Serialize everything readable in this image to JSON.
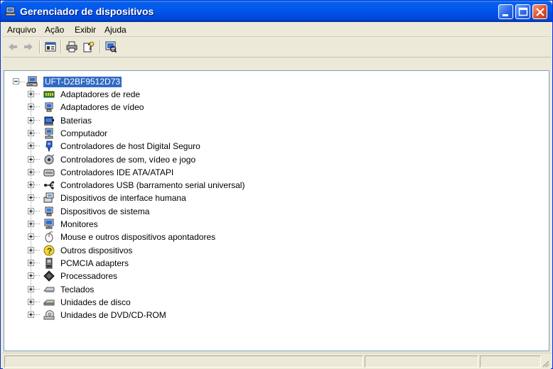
{
  "window": {
    "title": "Gerenciador de dispositivos",
    "colors": {
      "titlebar": "#0058ee",
      "selection": "#316ac5",
      "close": "#e0502a"
    }
  },
  "menubar": {
    "items": [
      {
        "label": "Arquivo"
      },
      {
        "label": "Ação"
      },
      {
        "label": "Exibir"
      },
      {
        "label": "Ajuda"
      }
    ]
  },
  "toolbar": {
    "buttons": [
      {
        "icon": "back-arrow-icon"
      },
      {
        "icon": "forward-arrow-icon"
      },
      {
        "icon": "properties-icon"
      },
      {
        "icon": "print-icon"
      },
      {
        "icon": "help-icon"
      },
      {
        "icon": "scan-hardware-icon"
      }
    ]
  },
  "tree": {
    "root": {
      "label": "UFT-D2BF9512D73",
      "icon": "computer-icon"
    },
    "items": [
      {
        "label": "Adaptadores de rede",
        "icon": "network-adapter-icon"
      },
      {
        "label": "Adaptadores de vídeo",
        "icon": "display-adapter-icon"
      },
      {
        "label": "Baterias",
        "icon": "battery-icon"
      },
      {
        "label": "Computador",
        "icon": "computer-icon"
      },
      {
        "label": "Controladores de host Digital Seguro",
        "icon": "sd-host-icon"
      },
      {
        "label": "Controladores de som, vídeo e jogo",
        "icon": "sound-icon"
      },
      {
        "label": "Controladores IDE ATA/ATAPI",
        "icon": "ide-controller-icon"
      },
      {
        "label": "Controladores USB (barramento serial universal)",
        "icon": "usb-icon"
      },
      {
        "label": "Dispositivos de interface humana",
        "icon": "hid-icon"
      },
      {
        "label": "Dispositivos de sistema",
        "icon": "system-device-icon"
      },
      {
        "label": "Monitores",
        "icon": "monitor-icon"
      },
      {
        "label": "Mouse e outros dispositivos apontadores",
        "icon": "mouse-icon"
      },
      {
        "label": "Outros dispositivos",
        "icon": "unknown-device-icon"
      },
      {
        "label": "PCMCIA adapters",
        "icon": "pcmcia-icon"
      },
      {
        "label": "Processadores",
        "icon": "processor-icon"
      },
      {
        "label": "Teclados",
        "icon": "keyboard-icon"
      },
      {
        "label": "Unidades de disco",
        "icon": "disk-drive-icon"
      },
      {
        "label": "Unidades de DVD/CD-ROM",
        "icon": "dvd-drive-icon"
      }
    ]
  }
}
